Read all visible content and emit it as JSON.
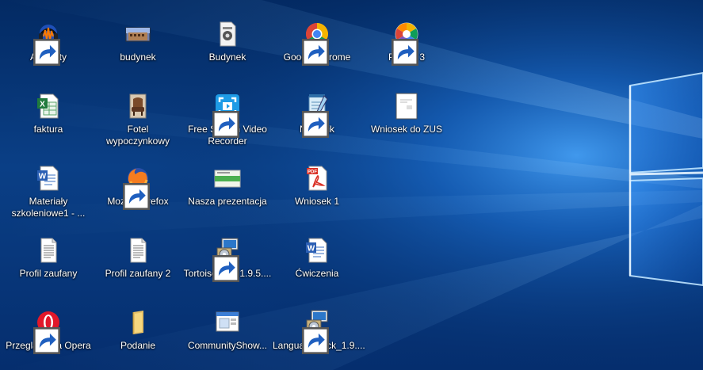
{
  "desktop": {
    "icons": [
      {
        "label": "Audacity",
        "icon": "audacity-icon"
      },
      {
        "label": "faktura",
        "icon": "excel-document-icon"
      },
      {
        "label": "Materiały\nszkoleniowe1 - ...",
        "icon": "word-document-icon"
      },
      {
        "label": "Profil zaufany",
        "icon": "text-document-icon"
      },
      {
        "label": "Przeglądarka Opera",
        "icon": "opera-browser-icon"
      },
      {
        "label": "budynek",
        "icon": "photo-building-icon"
      },
      {
        "label": "Fotel\nwypoczynkowy",
        "icon": "photo-armchair-icon"
      },
      {
        "label": "Mozilla Firefox",
        "icon": "firefox-browser-icon"
      },
      {
        "label": "Profil zaufany 2",
        "icon": "text-document-icon"
      },
      {
        "label": "Podanie",
        "icon": "folder-icon"
      },
      {
        "label": "Budynek",
        "icon": "media-file-icon"
      },
      {
        "label": "Free Screen Video\nRecorder",
        "icon": "screen-recorder-icon"
      },
      {
        "label": "Nasza prezentacja",
        "icon": "presentation-icon"
      },
      {
        "label": "TortoiseSVN-1.9.5....",
        "icon": "installer-package-icon"
      },
      {
        "label": "CommunityShow...",
        "icon": "window-app-icon"
      },
      {
        "label": "Google Chrome",
        "icon": "chrome-browser-icon"
      },
      {
        "label": "Notatnik",
        "icon": "notepad-icon"
      },
      {
        "label": "Wniosek 1",
        "icon": "pdf-document-icon"
      },
      {
        "label": "Ćwiczenia",
        "icon": "word-document-icon"
      },
      {
        "label": "LanguagePack_1.9....",
        "icon": "installer-package-icon"
      },
      {
        "label": "Picasa 3",
        "icon": "picasa-icon"
      },
      {
        "label": "Wniosek do ZUS",
        "icon": "blank-document-icon"
      }
    ]
  },
  "colors": {
    "wallpaper_dark": "#032a63",
    "wallpaper_light": "#1e78d8",
    "label_text": "#ffffff"
  }
}
